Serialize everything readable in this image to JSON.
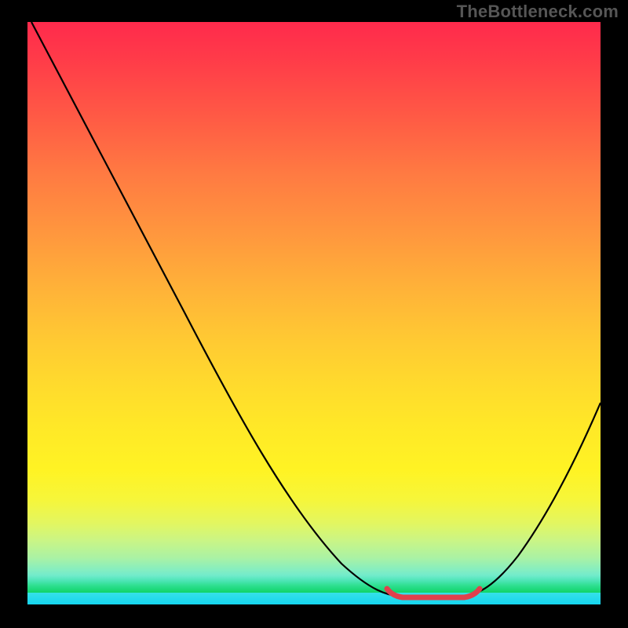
{
  "watermark": "TheBottleneck.com",
  "chart_data": {
    "type": "line",
    "title": "",
    "xlabel": "",
    "ylabel": "",
    "xlim": [
      0,
      100
    ],
    "ylim": [
      0,
      100
    ],
    "series": [
      {
        "name": "bottleneck-curve",
        "x": [
          0,
          5,
          10,
          15,
          20,
          25,
          30,
          35,
          40,
          45,
          50,
          55,
          60,
          65,
          70,
          75,
          80,
          85,
          90,
          95,
          100
        ],
        "values": [
          100,
          93,
          85,
          77,
          69,
          61,
          53,
          45,
          37,
          29,
          21,
          13,
          6,
          1,
          0,
          0,
          2,
          8,
          17,
          27,
          38
        ]
      }
    ],
    "annotations": [
      {
        "name": "optimal-range",
        "x_start": 63,
        "x_end": 77,
        "y": 0
      }
    ],
    "colors": {
      "curve": "#000000",
      "optimal_marker": "#e0404d",
      "gradient_top": "#ff2a4c",
      "gradient_bottom": "#15d5ef"
    }
  }
}
